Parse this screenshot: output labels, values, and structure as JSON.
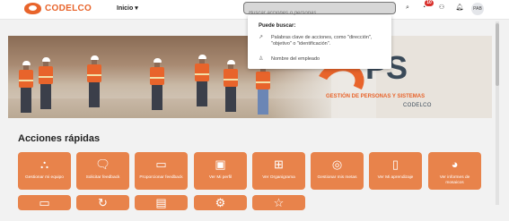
{
  "header": {
    "brand": "CODELCO",
    "nav_home": "Inicio ▾",
    "search_placeholder": "Buscar acciones o personas",
    "notifications_count": "10",
    "avatar_initials": "PAB"
  },
  "search_dropdown": {
    "title": "Puede buscar:",
    "option_actions": "Palabras clave de acciones, como \"dirección\", \"objetivo\" o \"identificación\".",
    "option_employee": "Nombre del empleado"
  },
  "hero": {
    "logo_text": "PS",
    "subtitle": "GESTIÓN DE PERSONAS Y SISTEMAS",
    "company": "CODELCO"
  },
  "quick_actions": {
    "title": "Acciones rápidas",
    "tiles": [
      {
        "label": "Gestionar mi equipo",
        "icon": "team-hierarchy-icon"
      },
      {
        "label": "Solicitar feedback",
        "icon": "feedback-request-icon"
      },
      {
        "label": "Proporcionar feedback",
        "icon": "feedback-give-icon"
      },
      {
        "label": "Ver Mi perfil",
        "icon": "profile-card-icon"
      },
      {
        "label": "Ver Organigrama",
        "icon": "org-chart-icon"
      },
      {
        "label": "Gestionar mis metas",
        "icon": "target-icon"
      },
      {
        "label": "Ver Mi aprendizaje",
        "icon": "book-icon"
      },
      {
        "label": "Ver informes de mosaicos",
        "icon": "report-icon"
      }
    ]
  },
  "colors": {
    "accent": "#e8642b",
    "tile": "#e8834b",
    "brand_dark": "#3a4a59"
  }
}
